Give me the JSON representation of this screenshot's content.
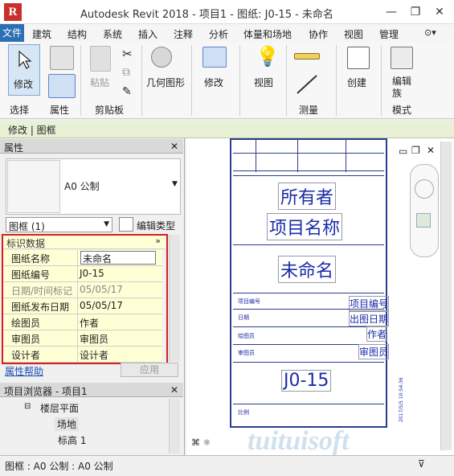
{
  "window": {
    "logo": "R",
    "title": "Autodesk Revit 2018 -    项目1 - 图纸: J0-15 - 未命名",
    "minimize": "—",
    "restore": "❐",
    "close": "✕"
  },
  "menu": {
    "file": "文件",
    "items": [
      "建筑",
      "结构",
      "系统",
      "插入",
      "注释",
      "分析",
      "体量和场地",
      "协作",
      "视图",
      "管理"
    ],
    "more": "⊙▾"
  },
  "ribbon": {
    "modify": "修改",
    "paste": "粘贴",
    "geometry": "几何图形",
    "modify2": "修改",
    "view": "视图",
    "create": "创建",
    "edit_family": "编辑族",
    "panels": {
      "select": "选择",
      "properties": "属性",
      "clipboard": "剪贴板",
      "measure": "测量",
      "mode": "模式"
    }
  },
  "context": {
    "label": "修改 | 图框"
  },
  "properties": {
    "header": "属性",
    "type_name": "A0 公制",
    "instance_filter": "图框 (1)",
    "edit_type": "编辑类型",
    "section": "标识数据",
    "rows": [
      {
        "k": "图纸名称",
        "v": "未命名"
      },
      {
        "k": "图纸编号",
        "v": "J0-15"
      },
      {
        "k": "日期/时间标记",
        "v": "05/05/17"
      },
      {
        "k": "图纸发布日期",
        "v": "05/05/17"
      },
      {
        "k": "绘图员",
        "v": "作者"
      },
      {
        "k": "审图员",
        "v": "审图员"
      },
      {
        "k": "设计者",
        "v": "设计者"
      }
    ],
    "help": "属性帮助",
    "apply": "应用"
  },
  "browser": {
    "header": "项目浏览器 - 项目1",
    "floor_plans": "楼层平面",
    "site": "场地",
    "level1": "标高 1"
  },
  "sheet": {
    "owner": "所有者",
    "project_name": "项目名称",
    "unnamed": "未命名",
    "project_no_label": "项目编号",
    "project_no": "项目编号",
    "date_label": "日期",
    "date": "出图日期",
    "drawn_label": "绘图员",
    "drawn": "作者",
    "checked_label": "审图员",
    "checked": "审图员",
    "sheet_no": "J0-15",
    "scale_label": "比例",
    "stamp": "2017/5/5 10:54:36"
  },
  "status": {
    "text": "图框 : A0 公制 : A0 公制"
  },
  "watermark": "tuituisoft"
}
